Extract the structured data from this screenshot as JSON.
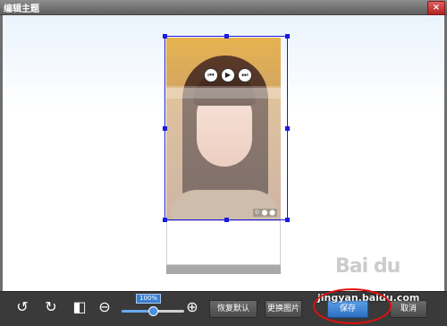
{
  "window": {
    "title": "编辑主题",
    "close_symbol": "×"
  },
  "photo": {
    "corner_badge": "© ⬤ ⬤"
  },
  "video_controls": [
    {
      "name": "prev-icon",
      "glyph": "⏮"
    },
    {
      "name": "play-icon",
      "glyph": "▶"
    },
    {
      "name": "next-icon",
      "glyph": "⏭"
    }
  ],
  "toolbar": {
    "rotate_left": "↺",
    "rotate_right": "↻",
    "flip": "◧",
    "zoom_out": "⊖",
    "zoom_in": "⊕",
    "zoom_level": "100%",
    "zoom_fraction": 0.48,
    "restore_default": "恢复默认",
    "change_image": "更换图片",
    "save": "保存",
    "cancel": "取消"
  },
  "watermark": {
    "text": "jingyan.baidu.com",
    "logo": "Bai du"
  },
  "colors": {
    "selection": "#1a1ae0",
    "save_button": "#2e6fc2",
    "highlight_ring": "#e01010"
  }
}
